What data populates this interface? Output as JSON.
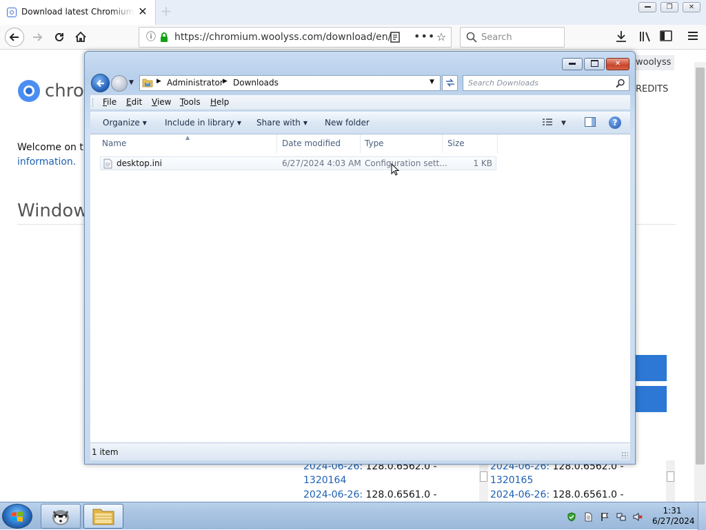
{
  "browser": {
    "tab_title": "Download latest Chromium rel",
    "url": "https://chromium.woolyss.com/download/en/",
    "search_placeholder": "Search",
    "tab_close": "✕",
    "new_tab": "+",
    "win_minimize": "▭",
    "win_restore": "❐",
    "win_close": "✕"
  },
  "page": {
    "brand": "chrom",
    "welcome": "Welcome on th",
    "info_link": "information.",
    "section_title": "Windows",
    "top_right_tab": "woolyss",
    "top_right_link": "REDITS",
    "releases": [
      {
        "date": "2024-06-26:",
        "version": " 128.0.6562.0 -",
        "build": "1320164"
      },
      {
        "date": "2024-06-26:",
        "version": " 128.0.6561.0 -"
      },
      {
        "date": "2024-06-26:",
        "version": " 128.0.6562.0 -",
        "build": "1320165"
      },
      {
        "date": "2024-06-26:",
        "version": " 128.0.6561.0 -"
      }
    ]
  },
  "explorer": {
    "breadcrumb": [
      "Administrator",
      "Downloads"
    ],
    "search_placeholder": "Search Downloads",
    "menu": [
      {
        "key": "F",
        "rest": "ile"
      },
      {
        "key": "E",
        "rest": "dit"
      },
      {
        "key": "V",
        "rest": "iew"
      },
      {
        "key": "T",
        "rest": "ools"
      },
      {
        "key": "H",
        "rest": "elp"
      }
    ],
    "commands": {
      "organize": "Organize",
      "include_in_library": "Include in library",
      "share_with": "Share with",
      "new_folder": "New folder"
    },
    "columns": {
      "name": "Name",
      "date_modified": "Date modified",
      "type": "Type",
      "size": "Size"
    },
    "files": [
      {
        "name": "desktop.ini",
        "date_modified": "6/27/2024 4:03 AM",
        "type": "Configuration sett...",
        "size": "1 KB"
      }
    ],
    "status": "1 item"
  },
  "taskbar": {
    "time": "1:31",
    "date": "6/27/2024"
  }
}
